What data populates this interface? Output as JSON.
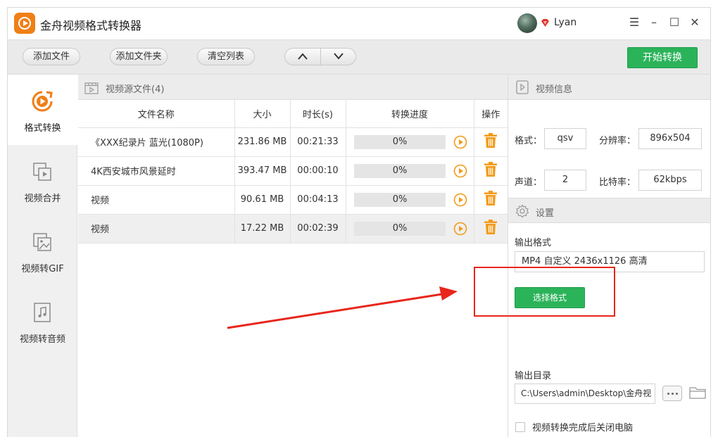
{
  "app": {
    "title": "金舟视频格式转换器",
    "user": "Lyan",
    "accent_color": "#2bb35a",
    "brand_color": "#f07f16"
  },
  "window_controls": {
    "menu": "☰",
    "minimize": "–",
    "maximize": "☐",
    "close": "✕"
  },
  "toolbar": {
    "add_file": "添加文件",
    "add_folder": "添加文件夹",
    "clear_list": "清空列表",
    "start": "开始转换"
  },
  "sidebar": {
    "items": [
      {
        "label": "格式转换",
        "icon": "play-circle-icon",
        "active": true
      },
      {
        "label": "视频合并",
        "icon": "video-merge-icon",
        "active": false
      },
      {
        "label": "视频转GIF",
        "icon": "image-icon",
        "active": false
      },
      {
        "label": "视频转音频",
        "icon": "music-icon",
        "active": false
      }
    ]
  },
  "source": {
    "header": "视频源文件(4)",
    "columns": [
      "文件名称",
      "大小",
      "时长(s)",
      "转换进度",
      "操作"
    ],
    "rows": [
      {
        "name": "《XXX纪录片 蓝光(1080P)",
        "size": "231.86 MB",
        "duration": "00:21:33",
        "progress": "0%"
      },
      {
        "name": "4K西安城市风景延时",
        "size": "393.47 MB",
        "duration": "00:00:10",
        "progress": "0%"
      },
      {
        "name": "视频",
        "size": "90.61 MB",
        "duration": "00:04:13",
        "progress": "0%"
      },
      {
        "name": "视频",
        "size": "17.22 MB",
        "duration": "00:02:39",
        "progress": "0%"
      }
    ]
  },
  "video_info": {
    "header": "视频信息",
    "format_label": "格式：",
    "format_value": "qsv",
    "resolution_label": "分辨率：",
    "resolution_value": "896x504",
    "channels_label": "声道：",
    "channels_value": "2",
    "bitrate_label": "比特率：",
    "bitrate_value": "62kbps"
  },
  "settings": {
    "header": "设置",
    "output_format_label": "输出格式",
    "output_format_value": "MP4 自定义 2436x1126 高清",
    "choose_format": "选择格式",
    "output_dir_label": "输出目录",
    "output_dir_value": "C:\\Users\\admin\\Desktop\\金舟视",
    "shutdown_label": "视频转换完成后关闭电脑"
  }
}
